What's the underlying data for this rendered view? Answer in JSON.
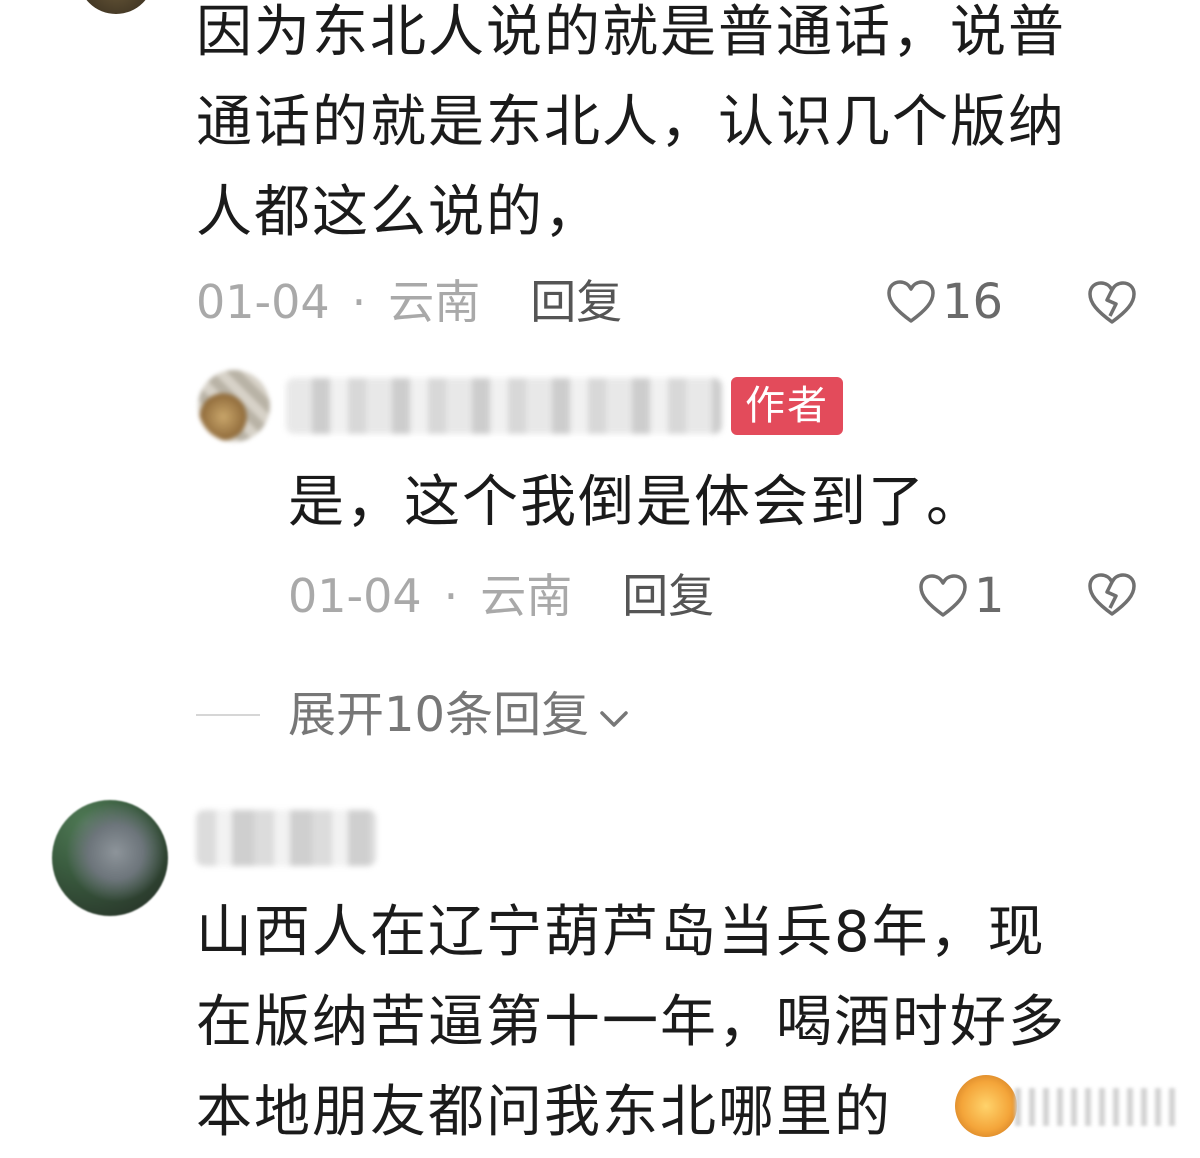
{
  "comment_1": {
    "text": "因为东北人说的就是普通话，说普\n通话的就是东北人，认识几个版纳\n人都这么说的，",
    "date": "01-04",
    "separator": "·",
    "location": "云南",
    "reply_label": "回复",
    "like_count": "16"
  },
  "author_reply": {
    "badge": "作者",
    "text": "是，这个我倒是体会到了。",
    "date": "01-04",
    "separator": "·",
    "location": "云南",
    "reply_label": "回复",
    "like_count": "1"
  },
  "expand_replies": {
    "label": "展开10条回复"
  },
  "comment_2": {
    "text": "山西人在辽宁葫芦岛当兵8年，现\n在版纳苦逼第十一年，喝酒时好多\n本地朋友都问我东北哪里的"
  },
  "icons": {
    "like": "heart-outline-icon",
    "dislike": "broken-heart-icon",
    "expand": "chevron-down-icon"
  },
  "colors": {
    "author_badge": "#e34b5b",
    "meta_text": "#a9a9a9",
    "body_text": "#1b1b1b"
  }
}
